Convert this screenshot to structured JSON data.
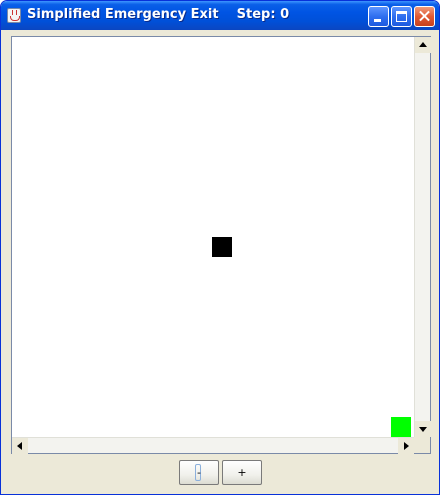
{
  "window": {
    "title": "Simplified Emergency Exit    Step: 0"
  },
  "icons": {
    "app": "java-cup-icon",
    "minimize": "minimize-icon",
    "maximize": "maximize-icon",
    "close": "close-icon"
  },
  "simulation": {
    "obstacle_color": "#000000",
    "exit_color": "#00ff00"
  },
  "controls": {
    "zoom_out_label": "-",
    "zoom_in_label": "+"
  },
  "colors": {
    "titlebar": "#0054e3",
    "window_bg": "#ece9d8"
  }
}
